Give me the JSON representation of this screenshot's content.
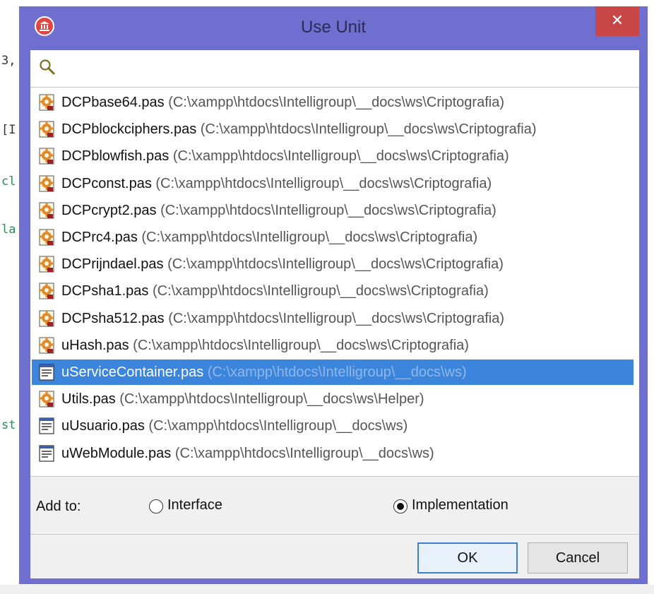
{
  "background": {
    "code_fragments": [
      {
        "text": "3,",
        "style": "dark"
      },
      {
        "text": "[I",
        "style": "dark"
      },
      {
        "text": "cl",
        "style": "green"
      },
      {
        "text": "la",
        "style": "green"
      },
      {
        "text": "st",
        "style": "green"
      }
    ]
  },
  "dialog": {
    "title": "Use Unit",
    "close_glyph": "✕",
    "accent_color": "#6f6fcf",
    "selection_color": "#3b86dc"
  },
  "search": {
    "value": "",
    "placeholder": ""
  },
  "units": [
    {
      "name": "DCPbase64.pas",
      "path": "(C:\\xampp\\htdocs\\Intelligroup\\__docs\\ws\\Criptografia)",
      "icon": "component-unit-icon",
      "selected": false
    },
    {
      "name": "DCPblockciphers.pas",
      "path": "(C:\\xampp\\htdocs\\Intelligroup\\__docs\\ws\\Criptografia)",
      "icon": "component-unit-icon",
      "selected": false
    },
    {
      "name": "DCPblowfish.pas",
      "path": "(C:\\xampp\\htdocs\\Intelligroup\\__docs\\ws\\Criptografia)",
      "icon": "component-unit-icon",
      "selected": false
    },
    {
      "name": "DCPconst.pas",
      "path": "(C:\\xampp\\htdocs\\Intelligroup\\__docs\\ws\\Criptografia)",
      "icon": "component-unit-icon",
      "selected": false
    },
    {
      "name": "DCPcrypt2.pas",
      "path": "(C:\\xampp\\htdocs\\Intelligroup\\__docs\\ws\\Criptografia)",
      "icon": "component-unit-icon",
      "selected": false
    },
    {
      "name": "DCPrc4.pas",
      "path": "(C:\\xampp\\htdocs\\Intelligroup\\__docs\\ws\\Criptografia)",
      "icon": "component-unit-icon",
      "selected": false
    },
    {
      "name": "DCPrijndael.pas",
      "path": "(C:\\xampp\\htdocs\\Intelligroup\\__docs\\ws\\Criptografia)",
      "icon": "component-unit-icon",
      "selected": false
    },
    {
      "name": "DCPsha1.pas",
      "path": "(C:\\xampp\\htdocs\\Intelligroup\\__docs\\ws\\Criptografia)",
      "icon": "component-unit-icon",
      "selected": false
    },
    {
      "name": "DCPsha512.pas",
      "path": "(C:\\xampp\\htdocs\\Intelligroup\\__docs\\ws\\Criptografia)",
      "icon": "component-unit-icon",
      "selected": false
    },
    {
      "name": "uHash.pas",
      "path": "(C:\\xampp\\htdocs\\Intelligroup\\__docs\\ws\\Criptografia)",
      "icon": "component-unit-icon",
      "selected": false
    },
    {
      "name": "uServiceContainer.pas",
      "path": "(C:\\xampp\\htdocs\\Intelligroup\\__docs\\ws)",
      "icon": "form-unit-icon",
      "selected": true
    },
    {
      "name": "Utils.pas",
      "path": "(C:\\xampp\\htdocs\\Intelligroup\\__docs\\ws\\Helper)",
      "icon": "component-unit-icon",
      "selected": false
    },
    {
      "name": "uUsuario.pas",
      "path": "(C:\\xampp\\htdocs\\Intelligroup\\__docs\\ws)",
      "icon": "form-unit-icon",
      "selected": false
    },
    {
      "name": "uWebModule.pas",
      "path": "(C:\\xampp\\htdocs\\Intelligroup\\__docs\\ws)",
      "icon": "form-unit-icon",
      "selected": false
    }
  ],
  "add_to": {
    "label": "Add to:",
    "options": [
      {
        "label": "Interface",
        "checked": false
      },
      {
        "label": "Implementation",
        "checked": true
      }
    ]
  },
  "buttons": {
    "ok": "OK",
    "cancel": "Cancel"
  }
}
